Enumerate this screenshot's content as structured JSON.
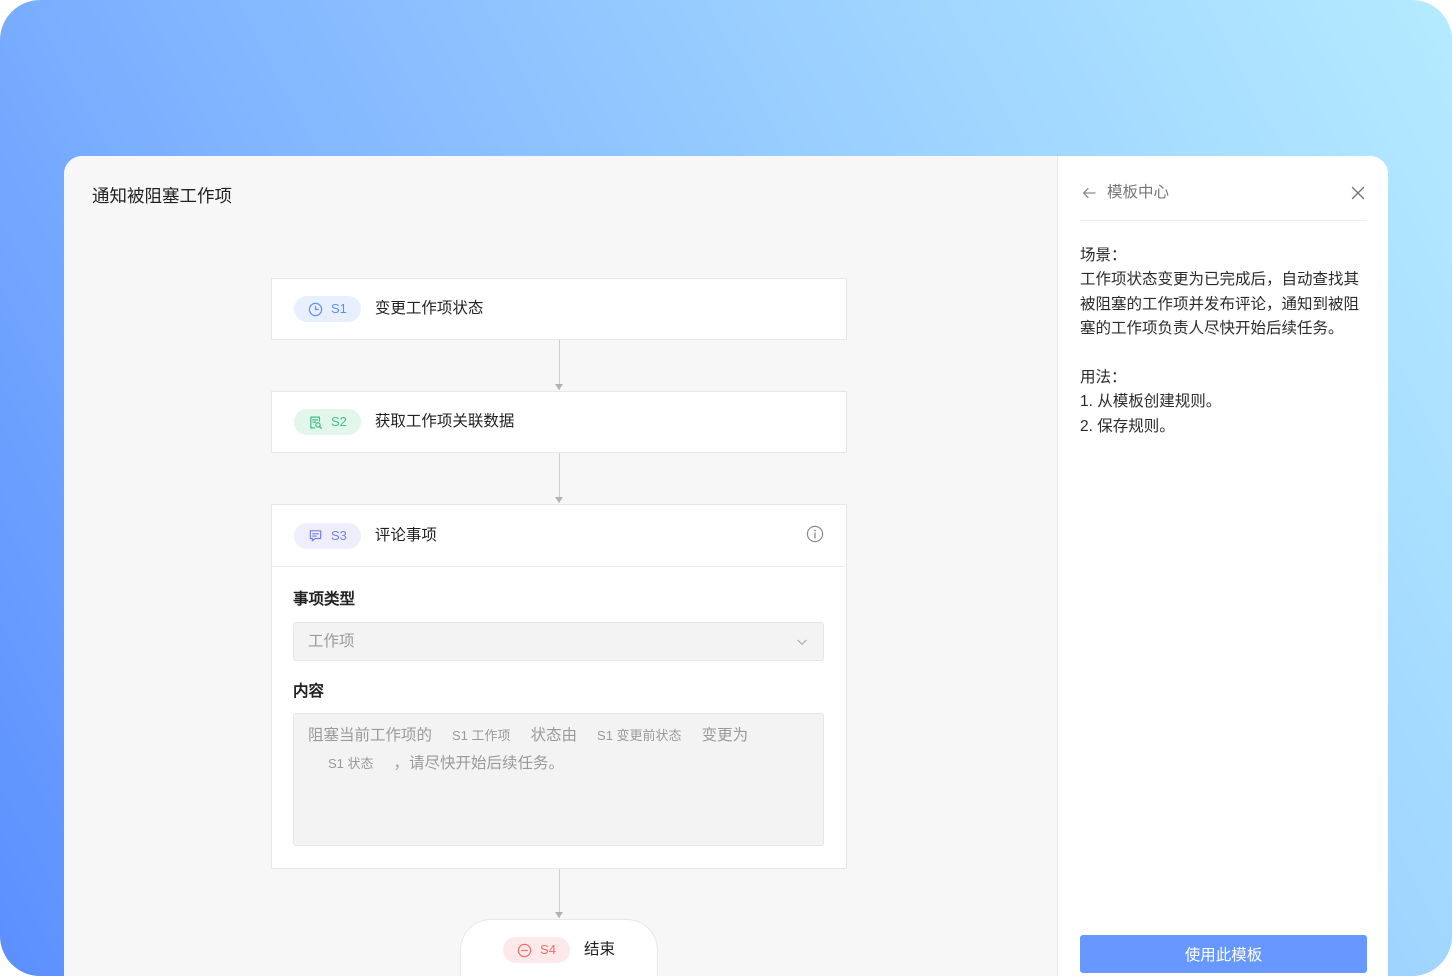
{
  "window": {
    "title": "通知被阻塞工作项"
  },
  "flow": {
    "steps": [
      {
        "id": "S1",
        "label": "变更工作项状态",
        "icon": "clock-icon",
        "color": "#5b8ff9",
        "bg": "#e8f0ff"
      },
      {
        "id": "S2",
        "label": "获取工作项关联数据",
        "icon": "document-search-icon",
        "color": "#3fbf7f",
        "bg": "#e3f6ec"
      },
      {
        "id": "S3",
        "label": "评论事项",
        "icon": "comment-icon",
        "info_icon": "info-icon",
        "color": "#7a7fe6",
        "bg": "#eeeefc"
      },
      {
        "id": "S4",
        "label": "结束",
        "icon": "minus-circle-icon",
        "color": "#f26d6d",
        "bg": "#fde9e9"
      }
    ],
    "comment_form": {
      "item_type": {
        "label": "事项类型",
        "value": "工作项",
        "icon": "chevron-down-icon"
      },
      "content": {
        "label": "内容",
        "segments": [
          {
            "text": "阻塞当前工作项的"
          },
          {
            "variable": "S1 工作项"
          },
          {
            "text": "状态由"
          },
          {
            "variable": "S1 变更前状态"
          },
          {
            "text": "变更为"
          },
          {
            "variable": "S1 状态"
          },
          {
            "text": "，请尽快开始后续任务。"
          }
        ]
      }
    }
  },
  "template_panel": {
    "back_icon": "arrow-left-icon",
    "back_label": "模板中心",
    "close_icon": "close-icon",
    "scenario_heading": "场景：",
    "scenario_text": "工作项状态变更为已完成后，自动查找其被阻塞的工作项并发布评论，通知到被阻塞的工作项负责人尽快开始后续任务。",
    "usage_heading": "用法：",
    "usage_steps": [
      "1. 从模板创建规则。",
      "2. 保存规则。"
    ],
    "use_button_label": "使用此模板"
  },
  "colors": {
    "primary_button": "#6698ff"
  }
}
